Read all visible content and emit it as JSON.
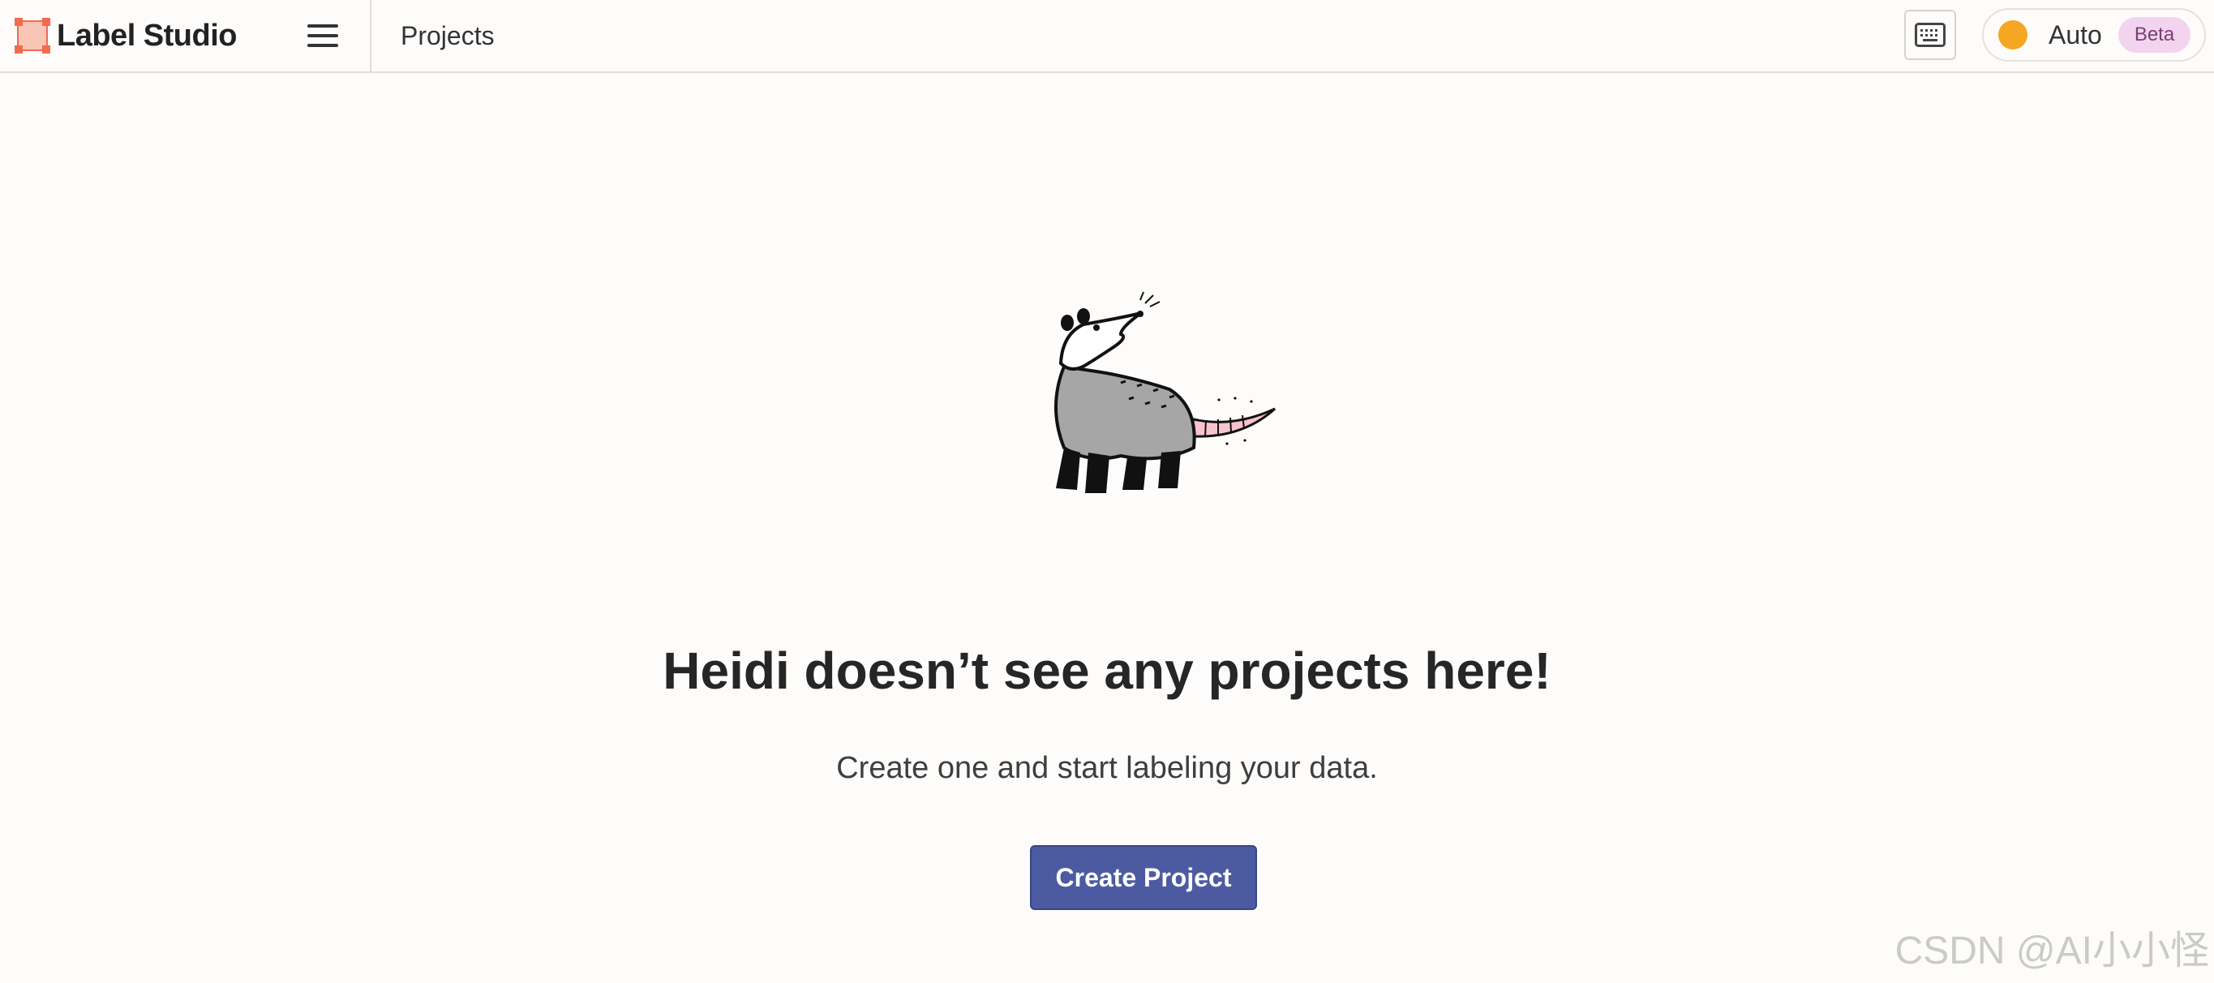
{
  "header": {
    "app_name": "Label Studio",
    "logo_icon": "label-studio-logo-icon",
    "menu_icon": "hamburger-menu-icon",
    "breadcrumb": "Projects",
    "hotkeys_icon": "keyboard-icon",
    "theme": {
      "label": "Auto",
      "badge": "Beta",
      "indicator_color": "#f5a623"
    }
  },
  "empty_state": {
    "illustration": "opossum-illustration",
    "title": "Heidi doesn’t see any projects here!",
    "subtitle": "Create one and start labeling your data.",
    "create_button_label": "Create Project"
  },
  "watermark": "CSDN @AI小小怪",
  "colors": {
    "accent": "#4c5ba1",
    "logo": "#f26b4f",
    "background": "#fdfcfb"
  }
}
